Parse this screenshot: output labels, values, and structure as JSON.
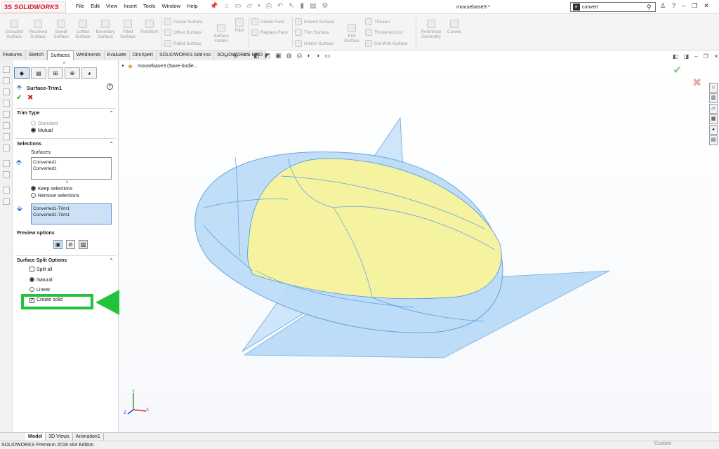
{
  "app": {
    "logo_mark": "3S",
    "logo_text": "SOLIDWORKS",
    "doc_title": "mousebase3 *"
  },
  "menu": [
    "File",
    "Edit",
    "View",
    "Insert",
    "Tools",
    "Window",
    "Help"
  ],
  "search": {
    "value": "convert"
  },
  "command_manager": {
    "tools": [
      "Extruded Surface",
      "Revolved Surface",
      "Swept Surface",
      "Lofted Surface",
      "Boundary Surface",
      "Filled Surface",
      "Freeform",
      "Surface Flatten",
      "Fillet",
      "Knit Surface",
      "Reference Geometry",
      "Curves"
    ],
    "rows": [
      "Planar Surface",
      "Offset Surface",
      "Ruled Surface",
      "Delete Face",
      "Replace Face",
      "Extend Surface",
      "Trim Surface",
      "Untrim Surface",
      "Thicken",
      "Thickened Cut",
      "Cut With Surface"
    ]
  },
  "tabs": [
    "Features",
    "Sketch",
    "Surfaces",
    "Weldments",
    "Evaluate",
    "DimXpert",
    "SOLIDWORKS Add-Ins",
    "SOLIDWORKS MBD"
  ],
  "active_tab": "Surfaces",
  "tree": {
    "item": "mousebase3  (Save-bodie..."
  },
  "pm": {
    "title": "Surface-Trim1",
    "help": "?",
    "trim_type": {
      "header": "Trim Type",
      "standard": "Standard",
      "mutual": "Mutual"
    },
    "selections": {
      "header": "Selections",
      "surfaces_label": "Surfaces:",
      "surfaces": [
        "Converted1",
        "Converted1"
      ],
      "keep": "Keep selections",
      "remove": "Remove selections",
      "pieces": [
        "Converted1-Trim1",
        "Converted1-Trim1"
      ]
    },
    "preview_header": "Preview options",
    "split": {
      "header": "Surface Split Options",
      "split_all": "Split all",
      "natural": "Natural",
      "linear": "Linear",
      "create_solid": "Create solid"
    }
  },
  "bottom_tabs": [
    "Model",
    "3D Views",
    "Animation1"
  ],
  "status": "SOLIDWORKS Premium 2018 x64 Edition",
  "units": "Custom",
  "axes": {
    "x": "X",
    "y": "Y",
    "z": "Z"
  },
  "colors": {
    "brand": "#c8102e",
    "highlight": "#22c23a",
    "surface_blue": "#8ec3f0",
    "solid_yellow": "#f5f3a0"
  }
}
